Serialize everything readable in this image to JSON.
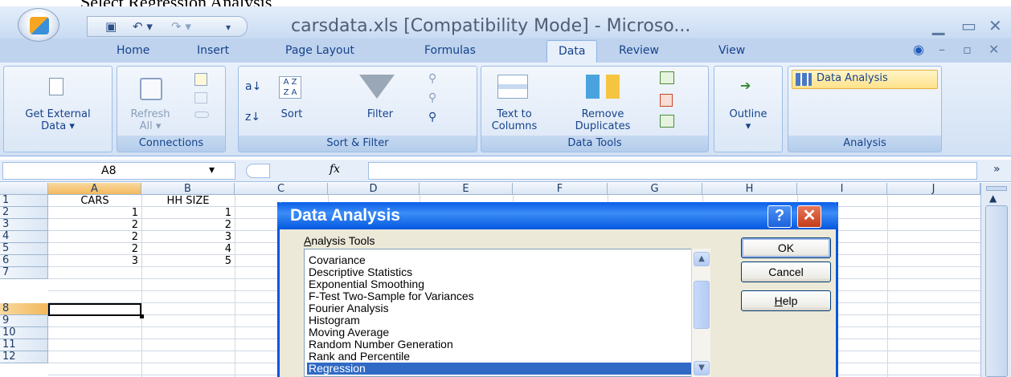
{
  "caption": "Select Regression Analysis",
  "window": {
    "title": "carsdata.xls  [Compatibility Mode] - Microso...",
    "qat_icons": [
      "save-icon",
      "undo-icon",
      "redo-icon"
    ]
  },
  "tabs": [
    "Home",
    "Insert",
    "Page Layout",
    "Formulas",
    "Data",
    "Review",
    "View"
  ],
  "active_tab": "Data",
  "ribbon": {
    "get_external_data": [
      "Get External",
      "Data ▾"
    ],
    "refresh_all": [
      "Refresh",
      "All ▾"
    ],
    "sort": "Sort",
    "filter": "Filter",
    "text_to_columns": [
      "Text to",
      "Columns"
    ],
    "remove_duplicates": [
      "Remove",
      "Duplicates"
    ],
    "outline": "Outline",
    "data_analysis": "Data Analysis",
    "groups": {
      "connections": "Connections",
      "sort_filter": "Sort & Filter",
      "data_tools": "Data Tools",
      "analysis": "Analysis"
    }
  },
  "formula_bar": {
    "name_box": "A8",
    "fx": "fx",
    "formula": ""
  },
  "sheet": {
    "columns": [
      "A",
      "B",
      "C",
      "D",
      "E",
      "F",
      "G",
      "H",
      "I",
      "J"
    ],
    "rows": [
      "1",
      "2",
      "3",
      "4",
      "5",
      "6",
      "7",
      "8",
      "9",
      "10",
      "11",
      "12"
    ],
    "headers": {
      "a": "CARS",
      "b": "HH SIZE"
    },
    "data": [
      {
        "cars": "1",
        "hh": "1"
      },
      {
        "cars": "2",
        "hh": "2"
      },
      {
        "cars": "2",
        "hh": "3"
      },
      {
        "cars": "2",
        "hh": "4"
      },
      {
        "cars": "3",
        "hh": "5"
      }
    ],
    "active_cell": "A8"
  },
  "dialog": {
    "title": "Data Analysis",
    "help_glyph": "?",
    "close_glyph": "✕",
    "list_label_first": "A",
    "list_label_rest": "nalysis Tools",
    "items": [
      "Covariance",
      "Descriptive Statistics",
      "Exponential Smoothing",
      "F-Test Two-Sample for Variances",
      "Fourier Analysis",
      "Histogram",
      "Moving Average",
      "Random Number Generation",
      "Rank and Percentile",
      "Regression"
    ],
    "selected_item": "Regression",
    "ok": "OK",
    "cancel": "Cancel",
    "help_first": "H",
    "help_rest": "elp"
  }
}
